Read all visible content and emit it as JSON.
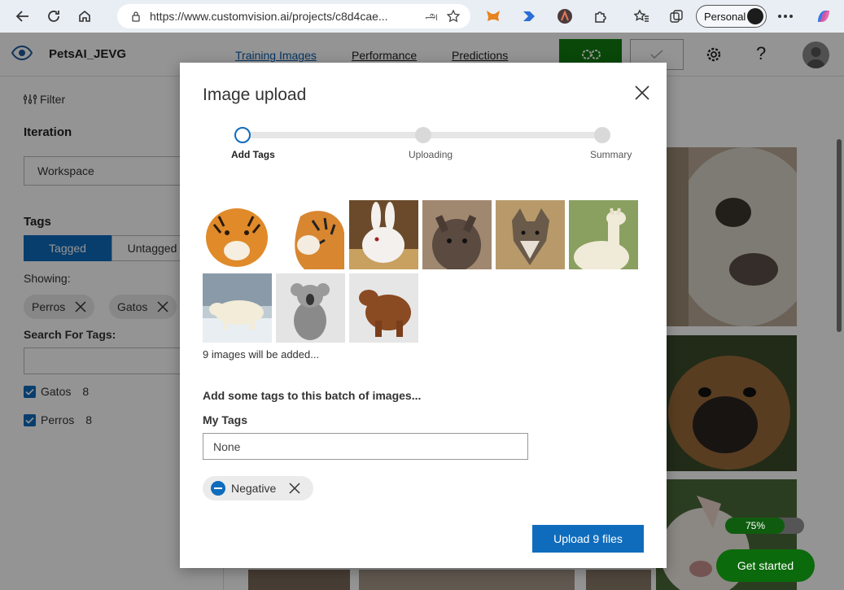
{
  "browser": {
    "url": "https://www.customvision.ai/projects/c8d4cae...",
    "read_aloud_glyph": "அ",
    "profile_label": "Personal"
  },
  "app": {
    "project_name": "PetsAI_JEVG",
    "tabs": [
      {
        "label": "Training Images",
        "active": true
      },
      {
        "label": "Performance",
        "active": false
      },
      {
        "label": "Predictions",
        "active": false
      }
    ],
    "help_glyph": "?"
  },
  "left_panel": {
    "filter_label": "Filter",
    "iteration_heading": "Iteration",
    "iteration_value": "Workspace",
    "tags_heading": "Tags",
    "tagged_label": "Tagged",
    "untagged_label": "Untagged",
    "showing_label": "Showing:",
    "showing_chips": [
      "Perros",
      "Gatos"
    ],
    "search_heading": "Search For Tags:",
    "tag_list": [
      {
        "name": "Gatos",
        "count": "8",
        "checked": true
      },
      {
        "name": "Perros",
        "count": "8",
        "checked": true
      }
    ]
  },
  "status": {
    "progress_text": "75%",
    "progress_value": 0.75,
    "get_started_label": "Get started"
  },
  "modal": {
    "title": "Image upload",
    "steps": [
      {
        "label": "Add Tags",
        "current": true
      },
      {
        "label": "Uploading",
        "current": false
      },
      {
        "label": "Summary",
        "current": false
      }
    ],
    "thumbnails": [
      "tiger-photo",
      "tiger-head-photo",
      "white-rabbit-photo",
      "kangaroo-photo",
      "wolf-photo",
      "llama-photo",
      "polar-bear-photo",
      "koala-photo",
      "brown-bear-photo"
    ],
    "count_text": "9 images will be added...",
    "tags_heading": "Add some tags to this batch of images...",
    "my_tags_label": "My Tags",
    "my_tags_placeholder": "None",
    "negative_chip": "Negative",
    "upload_button": "Upload 9 files"
  },
  "colors": {
    "primary": "#0f6cbd",
    "train_green": "#107c10",
    "get_started_green": "#0b6a0b"
  }
}
